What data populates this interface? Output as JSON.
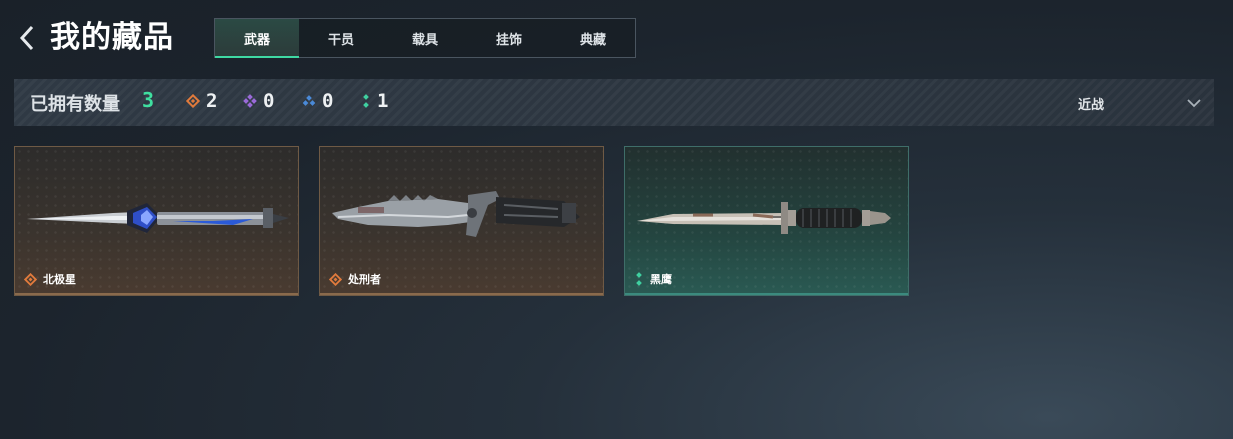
{
  "header": {
    "title": "我的藏品",
    "tabs": [
      {
        "label": "武器",
        "active": true
      },
      {
        "label": "干员",
        "active": false
      },
      {
        "label": "载具",
        "active": false
      },
      {
        "label": "挂饰",
        "active": false
      },
      {
        "label": "典藏",
        "active": false
      }
    ]
  },
  "filter": {
    "owned_label": "已拥有数量",
    "owned_count": "3",
    "rarity_counts": [
      {
        "icon": "orange-diamond-icon",
        "color": "#e07a3c",
        "count": "2"
      },
      {
        "icon": "purple-diamond-icon",
        "color": "#9a6ad8",
        "count": "0"
      },
      {
        "icon": "blue-diamond-icon",
        "color": "#4a8ad8",
        "count": "0"
      },
      {
        "icon": "teal-dots-icon",
        "color": "#3fd0a0",
        "count": "1"
      }
    ],
    "type_select": {
      "value": "近战"
    }
  },
  "items": [
    {
      "name": "北极星",
      "rarity_icon": "orange-diamond-icon",
      "weapon_icon": "dagger-icon"
    },
    {
      "name": "处刑者",
      "rarity_icon": "orange-diamond-icon",
      "weapon_icon": "serrated-knife-icon"
    },
    {
      "name": "黑鹰",
      "rarity_icon": "teal-dots-icon",
      "weapon_icon": "combat-knife-icon"
    }
  ],
  "colors": {
    "accent": "#3fe0a0",
    "gold_rarity": "#e07a3c",
    "teal_rarity": "#3fd0a0"
  }
}
